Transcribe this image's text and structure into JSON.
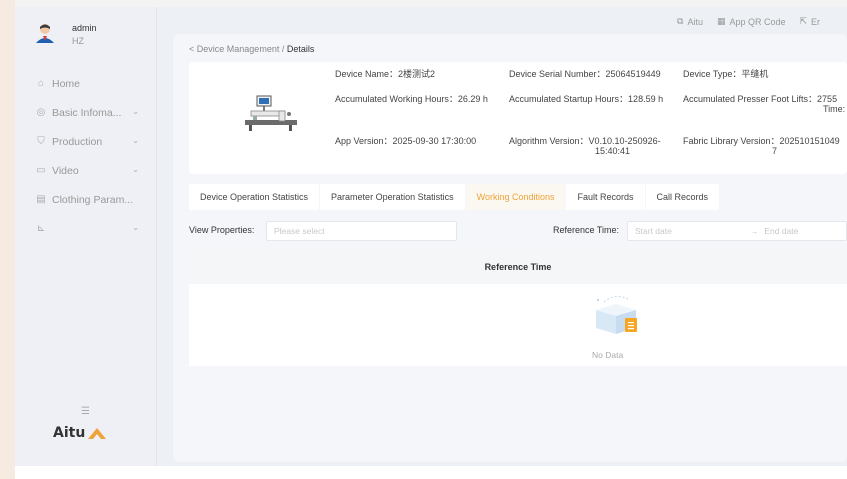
{
  "user": {
    "name": "admin",
    "org": "HZ"
  },
  "sidebar": {
    "items": [
      {
        "label": "Home",
        "icon": "home-icon",
        "chevron": false
      },
      {
        "label": "Basic Infoma...",
        "icon": "info-icon",
        "chevron": true
      },
      {
        "label": "Production",
        "icon": "production-icon",
        "chevron": true
      },
      {
        "label": "Video",
        "icon": "video-icon",
        "chevron": true
      },
      {
        "label": "Clothing Param...",
        "icon": "clothing-icon",
        "chevron": false
      },
      {
        "label": "",
        "icon": "chart-icon",
        "chevron": true
      }
    ],
    "collapse_icon": "menu-collapse-icon",
    "logo_text": "Aitu"
  },
  "header": {
    "links": [
      {
        "label": "Aitu",
        "icon": "external-link-icon"
      },
      {
        "label": "App QR Code",
        "icon": "qr-code-icon"
      },
      {
        "label": "Er",
        "icon": "export-icon"
      }
    ]
  },
  "breadcrumb": {
    "back_icon": "chevron-left-icon",
    "parent": "Device Management",
    "separator": "/",
    "current": "Details"
  },
  "device": {
    "name": "Device Name：2楼测试2",
    "serial": "Device Serial Number：25064519449",
    "type": "Device Type：平缝机",
    "working_hours": "Accumulated Working Hours：26.29 h",
    "startup_hours": "Accumulated Startup Hours：128.59 h",
    "presser_lifts": "Accumulated Presser Foot Lifts：2755",
    "presser_lifts_unit": "Time:",
    "app_version": "App Version：2025-09-30 17:30:00",
    "algorithm_version": "Algorithm Version：V0.10.10-250926-",
    "algorithm_version_2": "15:40:41",
    "fabric_version": "Fabric Library Version：202510151049",
    "fabric_version_2": "7"
  },
  "tabs": [
    {
      "label": "Device Operation Statistics",
      "active": false
    },
    {
      "label": "Parameter Operation Statistics",
      "active": false
    },
    {
      "label": "Working Conditions",
      "active": true
    },
    {
      "label": "Fault Records",
      "active": false
    },
    {
      "label": "Call Records",
      "active": false
    }
  ],
  "filters": {
    "view_label": "View Properties:",
    "view_placeholder": "Please select",
    "ref_label": "Reference Time:",
    "start_placeholder": "Start date",
    "arrow": "→",
    "end_placeholder": "End date"
  },
  "table": {
    "columns": [
      "Reference Time"
    ],
    "empty_text": "No Data"
  },
  "colors": {
    "accent": "#f0a33a",
    "background": "#edf0f5",
    "card": "#f4f6f9"
  }
}
